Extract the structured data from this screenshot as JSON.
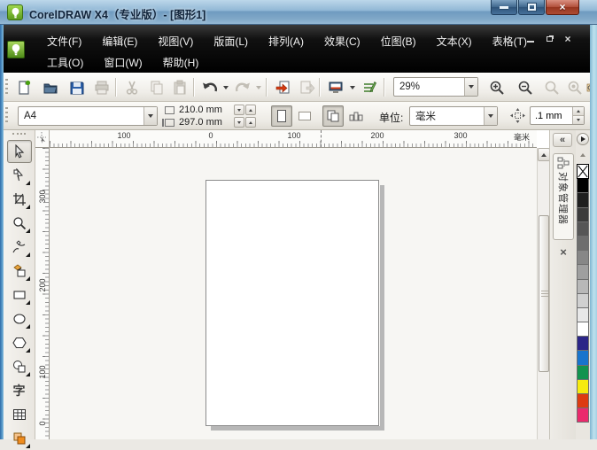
{
  "window": {
    "title": "CorelDRAW X4（专业版）- [图形1]",
    "controls": [
      "minimize",
      "maximize",
      "close"
    ],
    "doc_controls": [
      "minimize",
      "restore",
      "close"
    ]
  },
  "menu": {
    "row1": [
      "文件(F)",
      "编辑(E)",
      "视图(V)",
      "版面(L)",
      "排列(A)",
      "效果(C)",
      "位图(B)",
      "文本(X)",
      "表格(T)"
    ],
    "row2": [
      "工具(O)",
      "窗口(W)",
      "帮助(H)"
    ]
  },
  "toolbar": {
    "zoom_level": "29%",
    "buttons": [
      "new",
      "open",
      "save",
      "print",
      "cut",
      "copy",
      "paste",
      "undo",
      "redo",
      "import",
      "export",
      "application-launcher",
      "welcome-screen",
      "zoom-in",
      "zoom-out",
      "zoom-selected",
      "zoom-all-objects",
      "zoom-page"
    ]
  },
  "property_bar": {
    "paper_size": "A4",
    "paper_width": "210.0 mm",
    "paper_height": "297.0 mm",
    "orientation": "portrait",
    "units_label": "单位:",
    "units_value": "毫米",
    "nudge_offset": ".1 mm"
  },
  "rulers": {
    "horizontal_labels": [
      "100",
      "0",
      "100",
      "200",
      "300"
    ],
    "unit_label": "毫米",
    "vertical_labels": [
      "300",
      "200",
      "100",
      "0"
    ]
  },
  "toolbox": {
    "tools": [
      "pick",
      "shape",
      "crop",
      "zoom",
      "freehand",
      "smart-fill",
      "rectangle",
      "ellipse",
      "polygon",
      "basic-shapes",
      "text",
      "table",
      "interactive-blend"
    ],
    "active_tool": "pick",
    "text_tool_glyph": "字"
  },
  "docker": {
    "collapse_glyph": "«",
    "tab_label": "对象管理器",
    "close_glyph": "×"
  },
  "palette": {
    "flyout_icon": "flyout-right",
    "scroll_up_icon": "scroll-up",
    "colors": [
      "none",
      "#000000",
      "#1f1f1f",
      "#3b3b3b",
      "#565656",
      "#6e6e6e",
      "#878787",
      "#9f9f9f",
      "#b8b8b8",
      "#d0d0d0",
      "#e8e8e8",
      "#ffffff",
      "#2b2587",
      "#1874cd",
      "#12934f",
      "#f6eb0e",
      "#dd3b11",
      "#ea2a6c"
    ]
  }
}
